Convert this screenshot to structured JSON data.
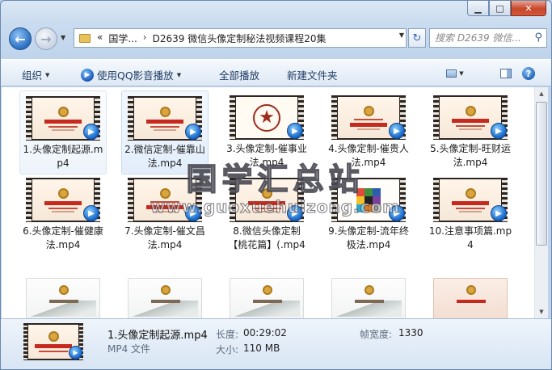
{
  "window": {
    "minimize_glyph": "▁",
    "maximize_glyph": "□",
    "close_glyph": "✕"
  },
  "navigation": {
    "back_icon": "back-arrow-icon",
    "forward_icon": "forward-arrow-icon",
    "breadcrumb": {
      "overflow": "«",
      "root": "国学...",
      "separator": "›",
      "current": "D2639 微信头像定制秘法视频课程20集"
    },
    "search_placeholder": "搜索 D2639 微信..."
  },
  "toolbar": {
    "organize": "组织",
    "play_with_qq": "使用QQ影音播放",
    "play_all": "全部播放",
    "new_folder": "新建文件夹"
  },
  "files": [
    {
      "label": "1.头像定制起源.mp4",
      "thumb": "poster"
    },
    {
      "label": "2.微信定制-催靠山法.mp4",
      "thumb": "poster"
    },
    {
      "label": "3.头像定制-催事业法.mp4",
      "thumb": "pentagram"
    },
    {
      "label": "4.头像定制-催贵人法.mp4",
      "thumb": "poster"
    },
    {
      "label": "5.头像定制-旺财运法.mp4",
      "thumb": "poster"
    },
    {
      "label": "6.头像定制-催健康法.mp4",
      "thumb": "poster"
    },
    {
      "label": "7.头像定制-催文昌法.mp4",
      "thumb": "poster"
    },
    {
      "label": "8.微信头像定制【桃花篇】(.mp4",
      "thumb": "poster"
    },
    {
      "label": "9.头像定制-流年终极法.mp4",
      "thumb": "bagua"
    },
    {
      "label": "10.注意事项篇.mp4",
      "thumb": "poster"
    }
  ],
  "watermark": {
    "chinese": "国学汇总站",
    "url": "www.guoxuehuizong.com"
  },
  "details": {
    "name": "1.头像定制起源.mp4",
    "type": "MP4 文件",
    "duration_label": "长度:",
    "duration_value": "00:29:02",
    "size_label": "大小:",
    "size_value": "110 MB",
    "framewidth_label": "帧宽度:",
    "framewidth_value": "1330"
  }
}
